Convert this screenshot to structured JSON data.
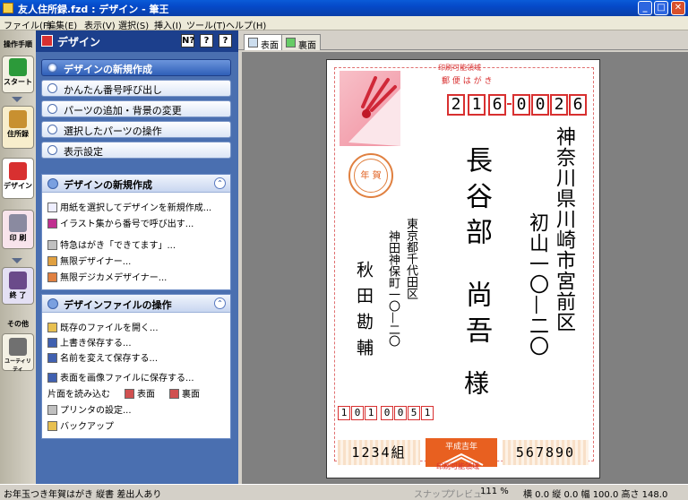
{
  "window": {
    "title": "友人住所録.fzd : デザイン - 筆王"
  },
  "menu": [
    "ファイル(F)",
    "編集(E)",
    "表示(V)",
    "選択(S)",
    "挿入(I)",
    "ツール(T)",
    "ヘルプ(H)"
  ],
  "lefttabs": {
    "header": "操作手順",
    "start": "スタート",
    "address": "住所録",
    "design": "デザイン",
    "print": "印 刷",
    "end": "終 了",
    "other": "その他",
    "utility": "ユーティリティ"
  },
  "panel": {
    "title": "デザイン",
    "help_buttons": [
      "N?",
      "?",
      "?"
    ],
    "main_buttons": [
      "デザインの新規作成",
      "かんたん番号呼び出し",
      "パーツの追加・背景の変更",
      "選択したパーツの操作",
      "表示設定"
    ],
    "box1": {
      "title": "デザインの新規作成",
      "items": [
        "用紙を選択してデザインを新規作成...",
        "イラスト集から番号で呼び出す...",
        "特急はがき「できてます」...",
        "無限デザイナー...",
        "無限デジカメデザイナー..."
      ]
    },
    "box2": {
      "title": "デザインファイルの操作",
      "items": [
        "既存のファイルを開く...",
        "上書き保存する...",
        "名前を変えて保存する...",
        "表面を画像ファイルに保存する..."
      ],
      "side_label": "片面を読み込む",
      "front": "表面",
      "back": "裏面",
      "more": [
        "プリンタの設定...",
        "バックアップ"
      ]
    }
  },
  "doctabs": [
    "表面",
    "裏面"
  ],
  "postcard": {
    "print_area": "印刷可能領域",
    "header": "郵 便 は が き",
    "postal_code": [
      "2",
      "1",
      "6",
      "0",
      "0",
      "2",
      "6"
    ],
    "recipient_address": [
      "神奈川県川崎市宮前区",
      "初山一〇—二〇"
    ],
    "recipient_name": [
      "長谷部",
      "尚吾",
      "様"
    ],
    "sender_address": [
      "東京都千代田区",
      "神田神保町一〇—二〇"
    ],
    "sender_name": "秋田勘輔",
    "sender_postal": [
      "1",
      "0",
      "1",
      "0",
      "0",
      "5",
      "1"
    ],
    "stamp_text": "年 賀",
    "lottery_left": "1234",
    "lottery_unit": "組",
    "lottery_center": "平成吉年",
    "lottery_right": "567890"
  },
  "status": {
    "left": "お年玉つき年賀はがき 縦書 差出人あり",
    "snap": "スナップ",
    "preview": "プレビュー",
    "zoom": "111 %",
    "coords": "横 0.0 縦 0.0 幅 100.0 高さ 148.0"
  },
  "colors": {
    "title": "#0549c8",
    "panel": "#4a6fb0",
    "accent": "#d83030"
  }
}
